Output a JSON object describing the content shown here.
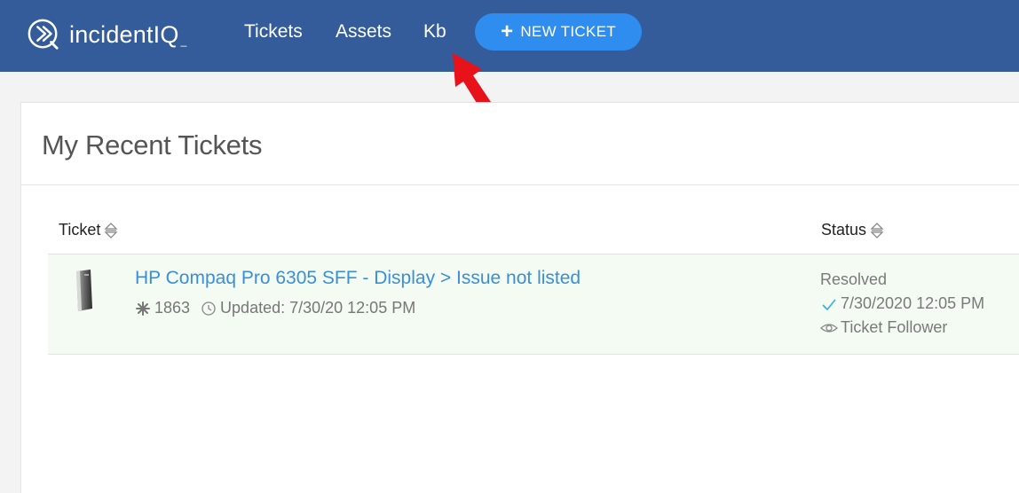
{
  "header": {
    "brand_name": "incidentIQ",
    "nav": [
      "Tickets",
      "Assets",
      "Kb"
    ],
    "new_ticket_label": "NEW TICKET",
    "accent": "#345c9b",
    "button_color": "#2f8df0"
  },
  "annotation": {
    "arrow_color": "#e8121a",
    "points_to": "Kb"
  },
  "panel": {
    "title": "My Recent Tickets",
    "columns": {
      "ticket": "Ticket",
      "status": "Status"
    },
    "rows": [
      {
        "icon": "desktop-tower-icon",
        "title": "HP Compaq Pro 6305 SFF - Display > Issue not listed",
        "number": "1863",
        "updated": "Updated: 7/30/20 12:05 PM",
        "status": "Resolved",
        "resolved_at": "7/30/2020 12:05 PM",
        "follow": "Ticket Follower"
      }
    ]
  }
}
